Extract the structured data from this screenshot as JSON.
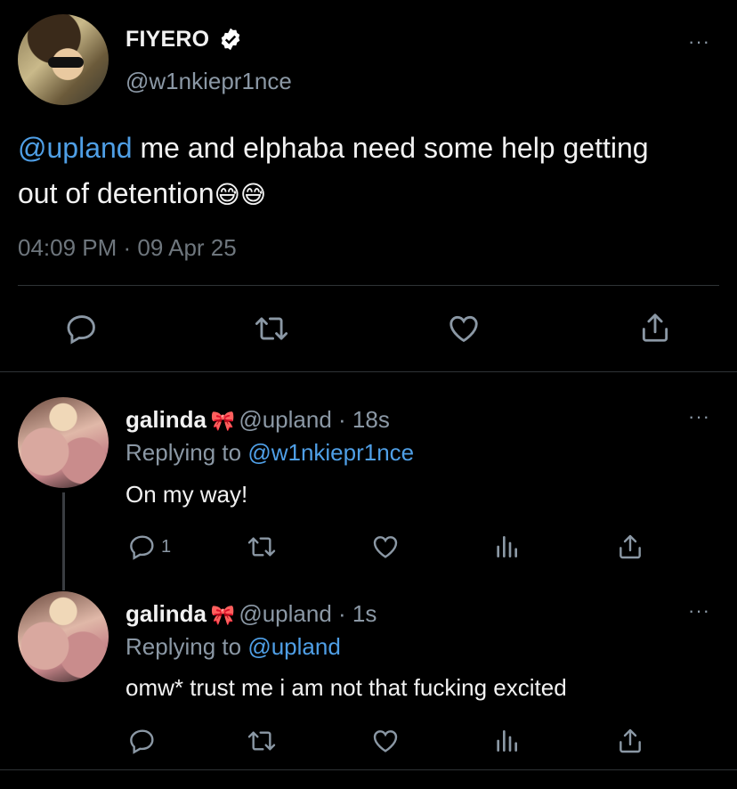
{
  "main_tweet": {
    "display_name": "FIYERO",
    "handle": "@w1nkiepr1nce",
    "mention": "@upland",
    "text": " me and elphaba need some help getting out of detention",
    "emojis": "😅😅",
    "timestamp": "04:09 PM · 09 Apr 25",
    "more": "···",
    "actions": [
      "reply-icon",
      "retweet-icon",
      "like-icon",
      "share-icon"
    ]
  },
  "replies": [
    {
      "display_name": "galinda",
      "bow": "🎀",
      "handle_time": "@upland · 18s",
      "replying_prefix": "Replying to ",
      "replying_to": "@w1nkiepr1nce",
      "text": "On my way!",
      "reply_count": "1",
      "more": "···"
    },
    {
      "display_name": "galinda",
      "bow": "🎀",
      "handle_time": "@upland · 1s",
      "replying_prefix": "Replying to ",
      "replying_to": "@upland",
      "text": "omw* trust me i am not that fucking excited",
      "reply_count": "",
      "more": "···"
    }
  ],
  "colors": {
    "background": "#000000",
    "link": "#4f9fe6",
    "muted": "#8b98a5",
    "divider": "#2f3336",
    "verified": "#ffffff"
  }
}
